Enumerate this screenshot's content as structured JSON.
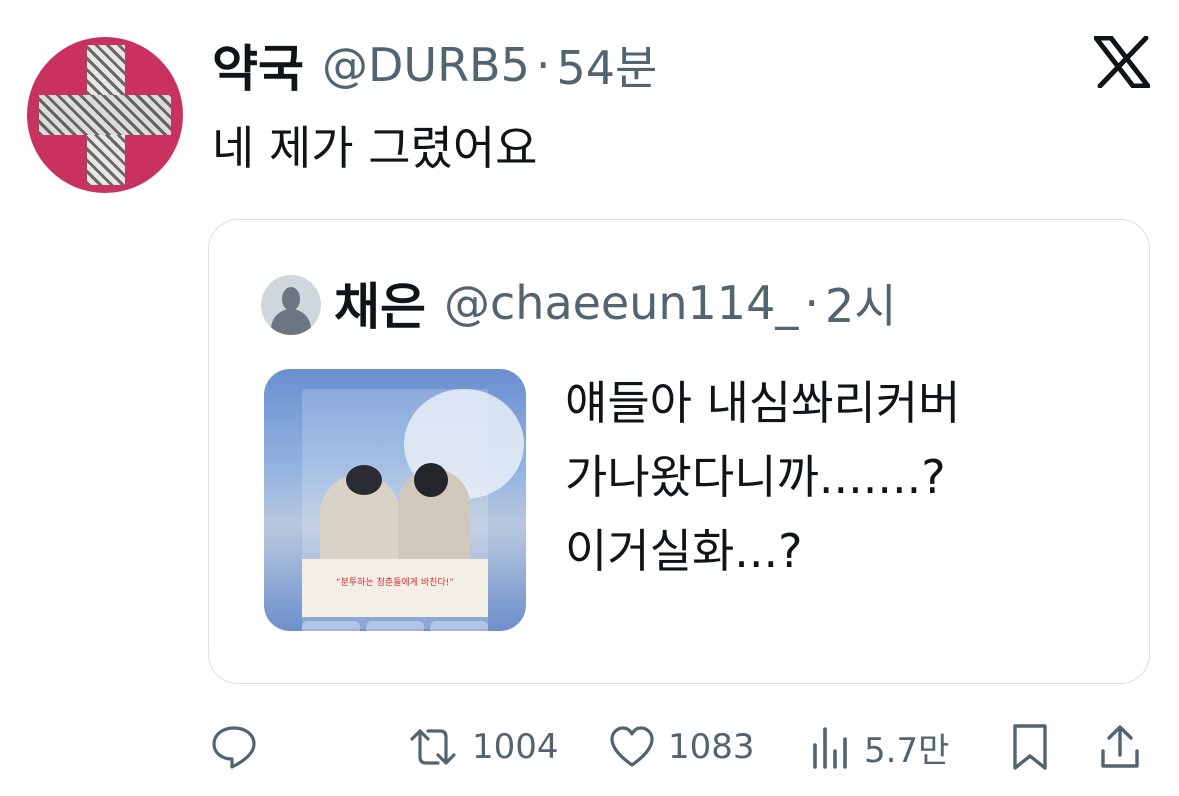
{
  "tweet": {
    "display_name": "약국",
    "handle": "@DURB5",
    "separator": "·",
    "time": "54분",
    "text": "네 제가 그렸어요",
    "avatar_icon": "red-cross-avatar-icon"
  },
  "quote": {
    "display_name": "채은",
    "handle": "@chaeeun114_",
    "separator": "·",
    "time": "2시",
    "text_lines": [
      "얘들아 내심쏴리커버",
      "가나왔다니까.......?",
      "이거실화...?"
    ],
    "image_band_text": "“분투하는 청춘들에게 바친다!”"
  },
  "actions": {
    "reply_icon": "reply-icon",
    "retweet_count": "1004",
    "like_count": "1083",
    "views_count": "5.7만",
    "bookmark_icon": "bookmark-icon",
    "share_icon": "share-icon"
  },
  "colors": {
    "text": "#0f1419",
    "secondary": "#536471",
    "border": "#dbe0e4",
    "avatar_bg": "#c9325e"
  }
}
